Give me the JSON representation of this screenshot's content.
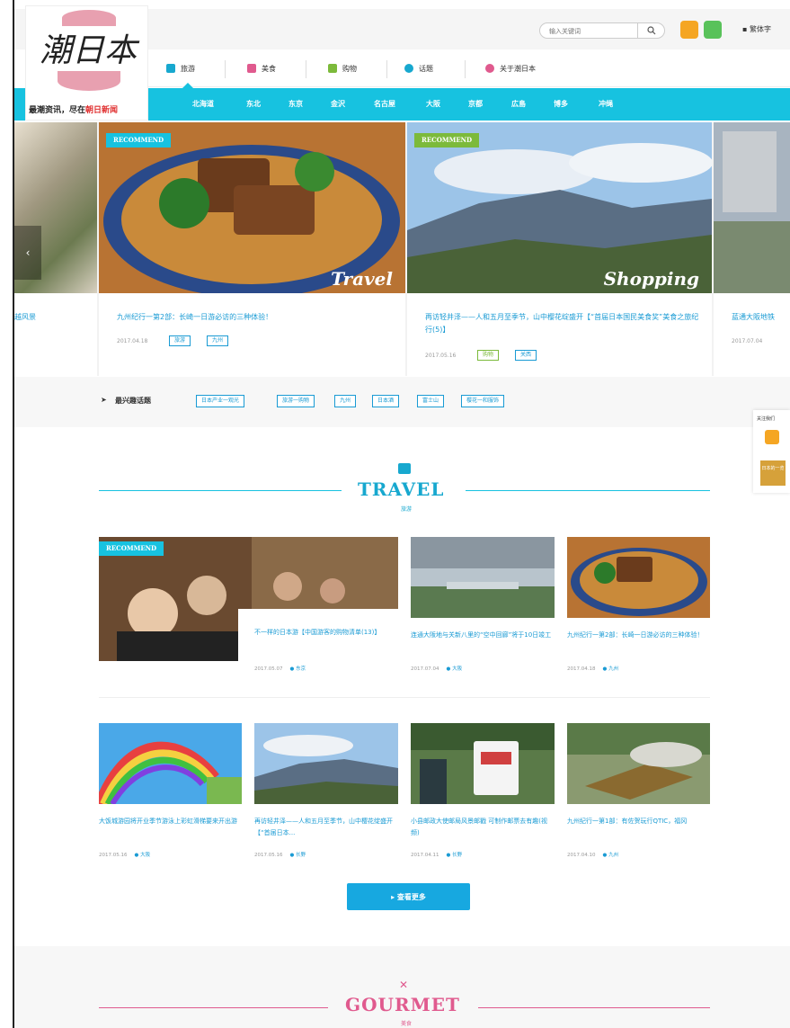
{
  "header": {
    "search_placeholder": "输入关键词",
    "lang": "▪ 繁体字"
  },
  "logo": {
    "text": "潮日本",
    "tag_prefix": "最潮资讯，尽在",
    "tag_brand": "朝日新闻"
  },
  "mainnav": {
    "items": [
      {
        "label": "旅游",
        "color": "#17a8cf"
      },
      {
        "label": "美食",
        "color": "#e05a8e"
      },
      {
        "label": "购物",
        "color": "#7cba3b"
      },
      {
        "label": "话题",
        "color": "#17a8cf"
      },
      {
        "label": "关于潮日本",
        "color": "#e05a8e"
      }
    ]
  },
  "subnav": {
    "items": [
      "北海道",
      "东北",
      "东京",
      "金沢",
      "名古屋",
      "大阪",
      "京都",
      "広島",
      "博多",
      "冲绳"
    ]
  },
  "carousel": {
    "left_caption": "越风景",
    "slides": [
      {
        "badge": "RECOMMEND",
        "badge_color": "#17c2e0",
        "script": "Travel",
        "title": "九州纪行一第2部：长崎一日游必访的三种体验！",
        "date": "2017.04.18",
        "tags": [
          "旅游",
          "九州"
        ]
      },
      {
        "badge": "RECOMMEND",
        "badge_color": "#7cba3b",
        "script": "Shopping",
        "title": "再访轻井泽——人和五月至季节，山中樱花绽盛开【“首届日本国民美食奖”美食之旅纪行(5)】",
        "date": "2017.05.16",
        "tags": [
          "购物",
          "关西"
        ]
      },
      {
        "badge": "",
        "badge_color": "#17c2e0",
        "script": "",
        "title": "蓝通大阪地铁",
        "date": "2017.07.04",
        "tags": []
      }
    ]
  },
  "hot": {
    "label": "最兴趣话题",
    "tags": [
      "日本产业一观光",
      "旅游一购物",
      "九州",
      "日本酒",
      "富士山",
      "樱花一和服饰"
    ]
  },
  "sidebar": {
    "label": "关注我们",
    "book": "日本的一览"
  },
  "travel": {
    "title": "TRAVEL",
    "sub": "旅游",
    "badge": "RECOMMEND",
    "row1": [
      {
        "title": "不一样的日本游【中国游客的购物清单(13)】",
        "date": "2017.05.07",
        "loc": "东京"
      },
      {
        "title": "连通大阪地与关新八里的“空中回廊”将于10日竣工",
        "date": "2017.07.04",
        "loc": "大阪"
      },
      {
        "title": "九州纪行一第2部：长崎一日游必访的三种体验！",
        "date": "2017.04.18",
        "loc": "九州"
      }
    ],
    "row2": [
      {
        "title": "大饭城游园将开业季节游泳上彩虹滑梯要来开出游",
        "date": "2017.05.16",
        "loc": "大阪"
      },
      {
        "title": "再访轻井泽——人和五月至季节，山中樱花绽盛开【“首届日本...",
        "date": "2017.05.16",
        "loc": "长野"
      },
      {
        "title": "小县邮政大使邮局风景邮戳 可制作邮票去有趣(视频)",
        "date": "2017.04.11",
        "loc": "长野"
      },
      {
        "title": "九州纪行一第1部：有佐贺玩行QTIC，福冈",
        "date": "2017.04.10",
        "loc": "九州"
      }
    ],
    "more": "▸  查看更多"
  },
  "gourmet": {
    "title": "GOURMET",
    "sub": "美食"
  }
}
